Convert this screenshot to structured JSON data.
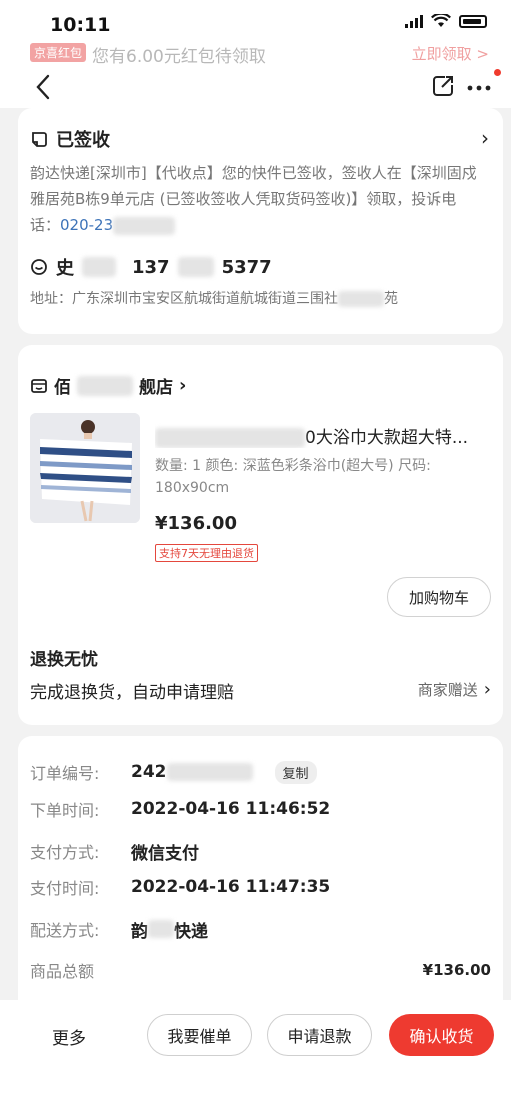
{
  "status_bar": {
    "time": "10:11"
  },
  "promo": {
    "tag": "京喜红包",
    "text": "您有6.00元红包待领取",
    "link": "立即领取 >"
  },
  "tracking": {
    "status": "已签收",
    "detail_main": "韵达快递[深圳市]【代收点】您的快件已签收，签收人在【深圳固戍雅居苑B栋9单元店 (已签收签收人凭取货码签收)】领取，投诉电话：",
    "phone": "020-23",
    "receiver_name": "史",
    "receiver_phone_start": "137",
    "receiver_phone_end": "5377",
    "address": "地址：广东深圳市宝安区航城街道航城街道三围社",
    "address_end": "苑"
  },
  "order_item": {
    "shop_start": "佰",
    "shop_end": "舰店",
    "title": "0大浴巾大款超大特...",
    "spec": "数量: 1  颜色: 深蓝色彩条浴巾(超大号)  尺码: 180x90cm",
    "price": "¥136.00",
    "return_tag": "支持7天无理由退货",
    "cart_button": "加购物车",
    "worry_title": "退换无忧",
    "worry_desc": "完成退换货，自动申请理赔",
    "worry_link": "商家赠送"
  },
  "order_info": {
    "number_label": "订单编号:",
    "number_value": "242",
    "copy_label": "复制",
    "time_label": "下单时间:",
    "time_value": "2022-04-16 11:46:52",
    "pay_method_label": "支付方式:",
    "pay_method_value": "微信支付",
    "pay_time_label": "支付时间:",
    "pay_time_value": "2022-04-16 11:47:35",
    "ship_label": "配送方式:",
    "ship_value_start": "韵",
    "ship_value_end": "快递",
    "total_label": "商品总额",
    "total_value": "¥136.00"
  },
  "bottom_bar": {
    "more": "更多",
    "urge": "我要催单",
    "refund": "申请退款",
    "confirm": "确认收货"
  },
  "colors": {
    "accent": "#ee3a30",
    "phone_link": "#3d73b8"
  }
}
